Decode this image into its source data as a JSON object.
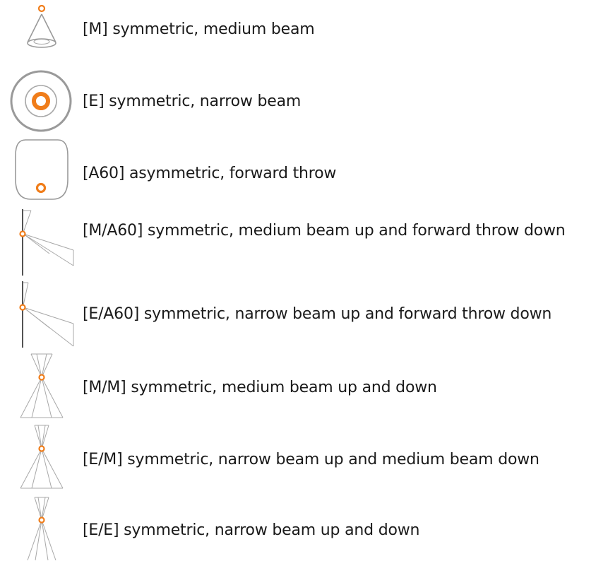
{
  "accent_color": "#f07d1a",
  "rows": [
    {
      "icon": "medium-beam-icon",
      "label": "[M] symmetric, medium beam"
    },
    {
      "icon": "narrow-beam-icon",
      "label": "[E] symmetric, narrow beam"
    },
    {
      "icon": "forward-throw-icon",
      "label": "[A60] asymmetric, forward throw"
    },
    {
      "icon": "medium-up-forward-down-icon",
      "label": "[M/A60] symmetric, medium beam up and forward throw down"
    },
    {
      "icon": "narrow-up-forward-down-icon",
      "label": "[E/A60] symmetric, narrow beam up and forward throw down"
    },
    {
      "icon": "medium-up-down-icon",
      "label": "[M/M] symmetric, medium beam up and down"
    },
    {
      "icon": "narrow-up-medium-down-icon",
      "label": "[E/M] symmetric, narrow beam up and medium beam down"
    },
    {
      "icon": "narrow-up-down-icon",
      "label": "[E/E] symmetric, narrow beam up and down"
    }
  ]
}
